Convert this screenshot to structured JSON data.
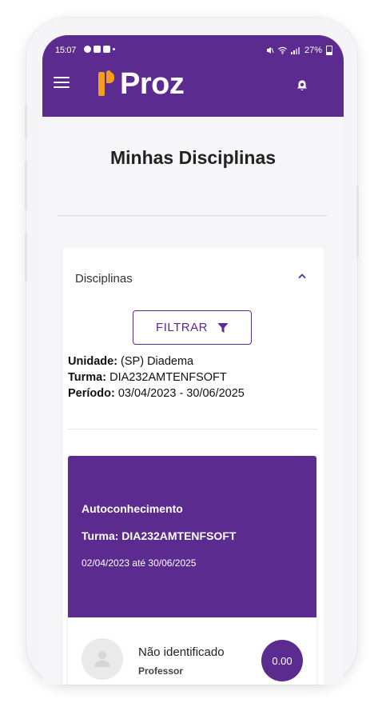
{
  "status_bar": {
    "time": "15:07",
    "battery": "27%",
    "icons": [
      "notification-icon",
      "message-icon",
      "app-s-icon",
      "mute-icon",
      "wifi-icon",
      "signal-icon",
      "battery-icon"
    ]
  },
  "navbar": {
    "logo_text": "Proz",
    "menu_icon": "hamburger-menu-icon",
    "notification_icon": "bell-icon"
  },
  "page": {
    "title": "Minhas Disciplinas"
  },
  "accordion": {
    "label": "Disciplinas",
    "expanded": true,
    "filter_label": "FILTRAR"
  },
  "info": {
    "unidade_label": "Unidade:",
    "unidade_value": " (SP) Diadema",
    "turma_label": "Turma:",
    "turma_value": " DIA232AMTENFSOFT",
    "periodo_label": "Período:",
    "periodo_value": " 03/04/2023 - 30/06/2025"
  },
  "discipline_card": {
    "name": "Autoconhecimento",
    "turma": "Turma: DIA232AMTENFSOFT",
    "period": "02/04/2023 até 30/06/2025",
    "professor_name": "Não identificado",
    "professor_role": "Professor",
    "grade": "0.00"
  },
  "colors": {
    "brand_purple": "#5b2b90",
    "logo_orange": "#f59e1e",
    "background": "#f6f6f8"
  }
}
